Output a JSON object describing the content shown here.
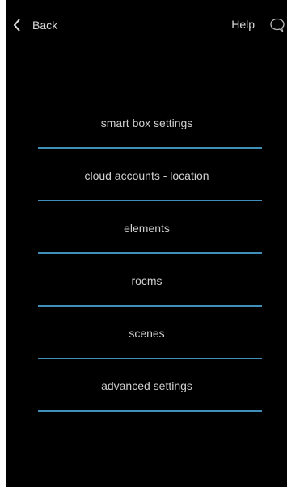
{
  "header": {
    "back_label": "Back",
    "back_icon": "chevron-left-icon",
    "help_label": "Help",
    "chat_icon": "speech-bubble-icon"
  },
  "menu": {
    "items": [
      {
        "label": "smart box settings"
      },
      {
        "label": "cloud accounts - location"
      },
      {
        "label": "elements"
      },
      {
        "label": "rocms"
      },
      {
        "label": "scenes"
      },
      {
        "label": "advanced settings"
      }
    ]
  },
  "colors": {
    "background": "#000000",
    "text": "#cfcfcf",
    "separator": "#3f8fb8"
  }
}
